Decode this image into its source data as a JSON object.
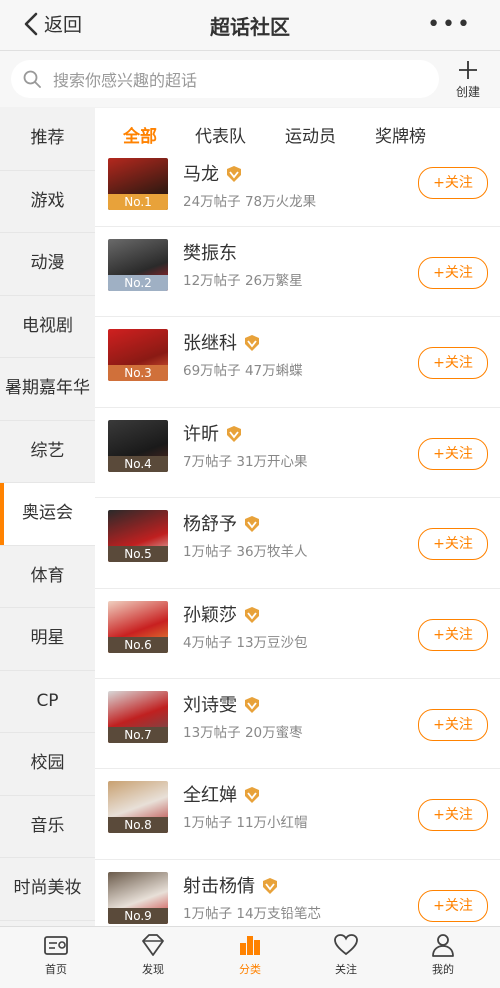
{
  "header": {
    "back_label": "返回",
    "title": "超话社区",
    "more": "•••"
  },
  "search": {
    "placeholder": "搜索你感兴趣的超话",
    "create_label": "创建"
  },
  "sidebar": {
    "items": [
      {
        "label": "推荐"
      },
      {
        "label": "游戏"
      },
      {
        "label": "动漫"
      },
      {
        "label": "电视剧"
      },
      {
        "label": "暑期嘉年华"
      },
      {
        "label": "综艺"
      },
      {
        "label": "奥运会"
      },
      {
        "label": "体育"
      },
      {
        "label": "明星"
      },
      {
        "label": "CP"
      },
      {
        "label": "校园"
      },
      {
        "label": "音乐"
      },
      {
        "label": "时尚美妆"
      }
    ]
  },
  "tabs": [
    {
      "label": "全部"
    },
    {
      "label": "代表队"
    },
    {
      "label": "运动员"
    },
    {
      "label": "奖牌榜"
    }
  ],
  "list": [
    {
      "name": "马龙",
      "meta": "24万帖子 78万火龙果",
      "rank": "No.1",
      "follow": "+关注"
    },
    {
      "name": "樊振东",
      "meta": "12万帖子 26万繁星",
      "rank": "No.2",
      "follow": "+关注"
    },
    {
      "name": "张继科",
      "meta": "69万帖子 47万蝌蝶",
      "rank": "No.3",
      "follow": "+关注"
    },
    {
      "name": "许昕",
      "meta": "7万帖子 31万开心果",
      "rank": "No.4",
      "follow": "+关注"
    },
    {
      "name": "杨舒予",
      "meta": "1万帖子 36万牧羊人",
      "rank": "No.5",
      "follow": "+关注"
    },
    {
      "name": "孙颖莎",
      "meta": "4万帖子 13万豆沙包",
      "rank": "No.6",
      "follow": "+关注"
    },
    {
      "name": "刘诗雯",
      "meta": "13万帖子 20万蜜枣",
      "rank": "No.7",
      "follow": "+关注"
    },
    {
      "name": "全红婵",
      "meta": "1万帖子 11万小红帽",
      "rank": "No.8",
      "follow": "+关注"
    },
    {
      "name": "射击杨倩",
      "meta": "1万帖子 14万支铅笔芯",
      "rank": "No.9",
      "follow": "+关注"
    }
  ],
  "bottom_nav": [
    {
      "label": "首页",
      "icon": "home-icon"
    },
    {
      "label": "发现",
      "icon": "discover-icon"
    },
    {
      "label": "分类",
      "icon": "category-icon"
    },
    {
      "label": "关注",
      "icon": "heart-icon"
    },
    {
      "label": "我的",
      "icon": "profile-icon"
    }
  ],
  "colors": {
    "accent": "#ff8200",
    "gold": "#e8a23a",
    "silver": "#9fb0c4",
    "bronze": "#d0703a",
    "rank_bg": "#5a4a3a"
  }
}
